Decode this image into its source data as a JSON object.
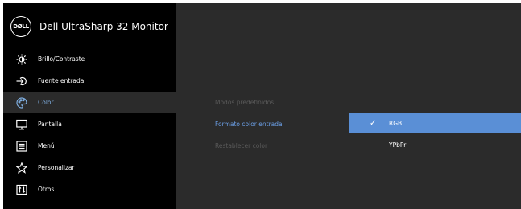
{
  "header": {
    "logo_text": "DØLL",
    "title": "Dell UltraSharp 32 Monitor"
  },
  "menu": {
    "items": [
      {
        "label": "Brillo/Contraste",
        "icon": "brightness-icon"
      },
      {
        "label": "Fuente entrada",
        "icon": "input-source-icon"
      },
      {
        "label": "Color",
        "icon": "color-palette-icon",
        "active": true
      },
      {
        "label": "Pantalla",
        "icon": "display-icon"
      },
      {
        "label": "Menú",
        "icon": "menu-icon"
      },
      {
        "label": "Personalizar",
        "icon": "star-icon"
      },
      {
        "label": "Otros",
        "icon": "others-icon"
      }
    ]
  },
  "submenu": {
    "items": [
      {
        "label": "Modos predefinidos"
      },
      {
        "label": "Formato color entrada",
        "selected": true
      },
      {
        "label": "Restablecer color"
      }
    ]
  },
  "options": {
    "items": [
      {
        "label": "RGB",
        "checked": true,
        "check": "✓"
      },
      {
        "label": "YPbPr"
      }
    ]
  },
  "colors": {
    "sidebar_bg": "#000000",
    "panel_bg": "#2b2b2b",
    "accent": "#5a8fd6",
    "active_text": "#7faee0"
  }
}
